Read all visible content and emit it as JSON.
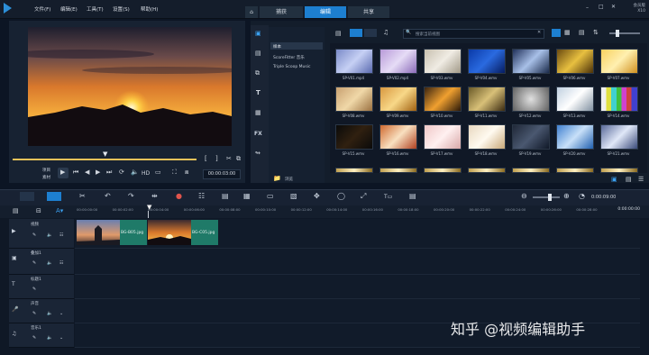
{
  "menu": {
    "items": [
      "文件(F)",
      "编辑(E)",
      "工具(T)",
      "设置(S)",
      "帮助(H)"
    ]
  },
  "tabs": [
    "捕获",
    "编辑",
    "共享"
  ],
  "active_tab": "编辑",
  "brand": {
    "line1": "会员版",
    "line2": "X10"
  },
  "player": {
    "project_label": "项目",
    "clip_label": "素材",
    "hd_label": "HD",
    "timecode": "00:00:03:00"
  },
  "library": {
    "add_label": "添加",
    "search_placeholder": "搜索当前视图",
    "folders": [
      "样本",
      "ScoreFitter 音乐",
      "Triple Scoop Music"
    ],
    "browse_label": "浏览",
    "thumbnails": [
      "SP-V01.mp4",
      "SP-V02.mp4",
      "SP-V03.wmv",
      "SP-V04.wmv",
      "SP-V05.wmv",
      "SP-V06.wmv",
      "SP-V07.wmv",
      "SP-V08.wmv",
      "SP-V09.wmv",
      "SP-V10.wmv",
      "SP-V11.wmv",
      "SP-V12.wmv",
      "SP-V13.wmv",
      "SP-V14.wmv",
      "SP-V15.wmv",
      "SP-V16.wmv",
      "SP-V17.wmv",
      "SP-V18.wmv",
      "SP-V19.wmv",
      "SP-V20.wmv",
      "SP-V21.wmv"
    ]
  },
  "timeline": {
    "timecode": "0:00:00:00",
    "ruler": [
      "00:00:00:00",
      "00:00:02:00",
      "00:00:04:00",
      "00:00:06:00",
      "00:00:08:00",
      "00:00:10:00",
      "00:00:12:00",
      "00:00:14:00",
      "00:00:16:00",
      "00:00:18:00",
      "00:00:20:00",
      "00:00:22:00",
      "00:00:24:00",
      "00:00:26:00",
      "00:00:28:00"
    ],
    "tracks": [
      "视频",
      "叠加1",
      "标题1",
      "声音",
      "音乐1"
    ],
    "clips": [
      "BG-B05.jpg",
      "BG-C05.jpg"
    ],
    "zoom_time": "0:00:09:00"
  },
  "watermark": "知乎 @视频编辑助手"
}
